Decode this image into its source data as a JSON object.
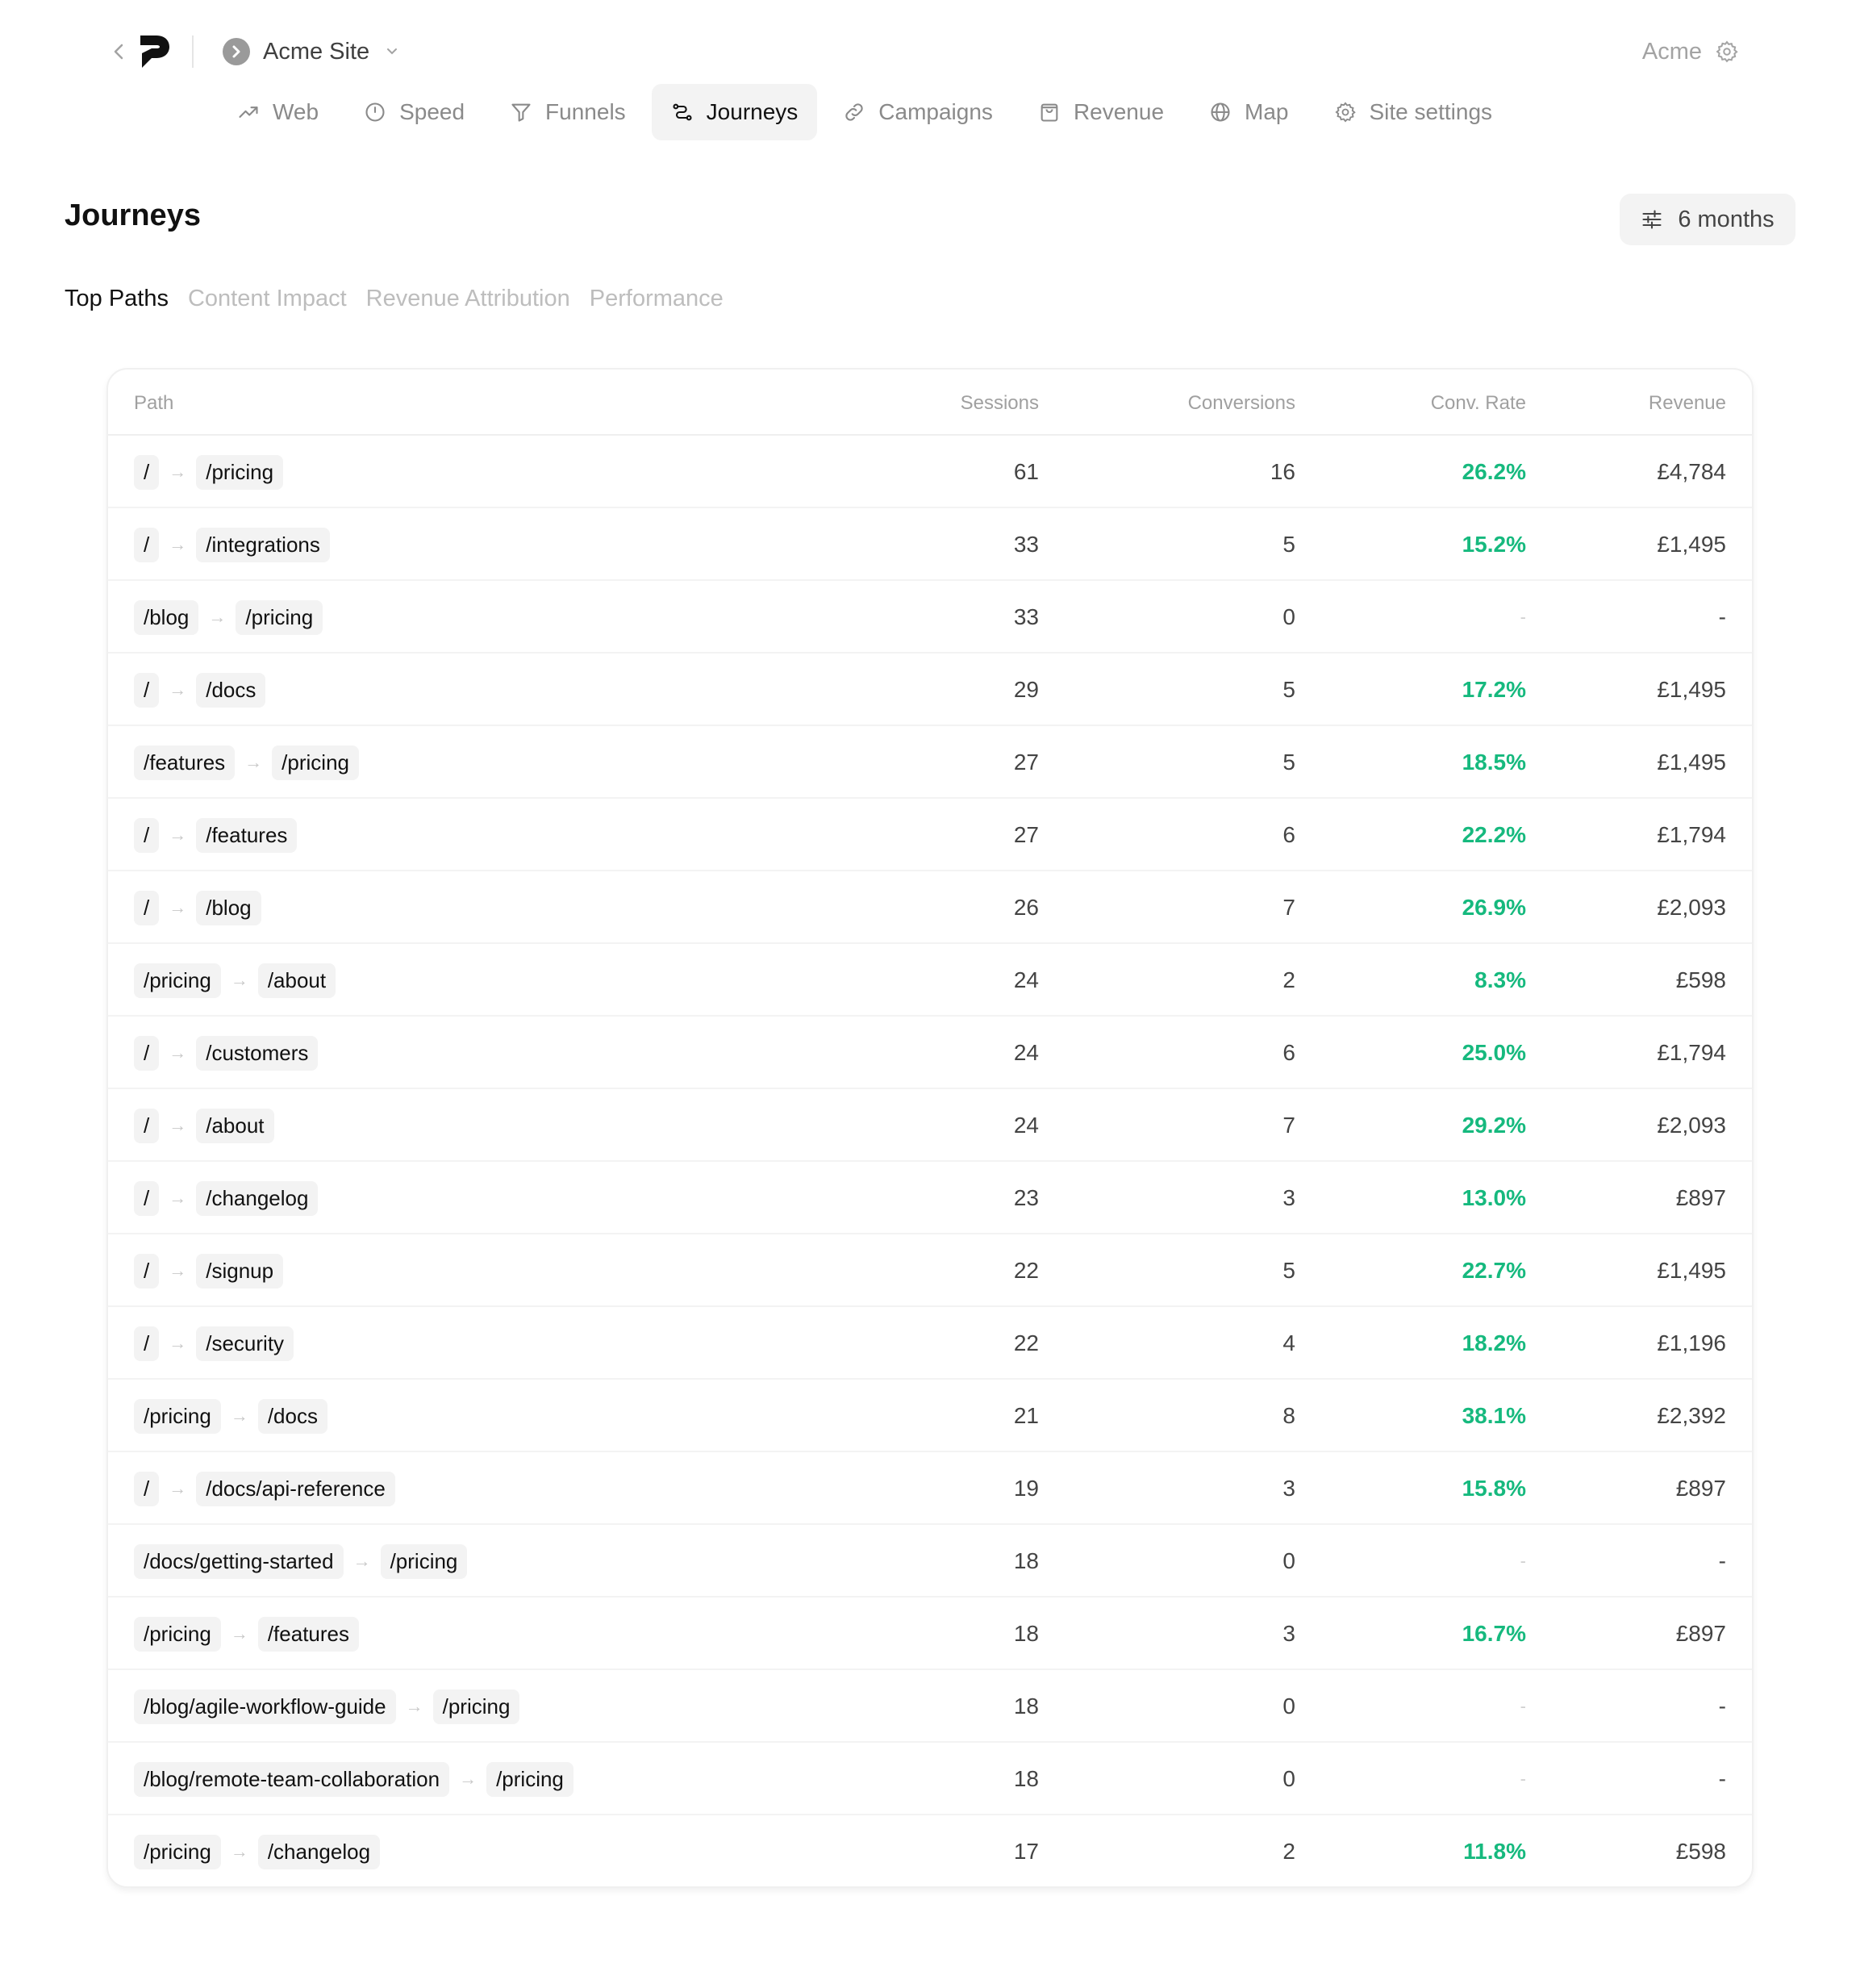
{
  "header": {
    "site_name": "Acme Site",
    "account_name": "Acme"
  },
  "nav": [
    {
      "label": "Web",
      "icon": "trend-up-icon",
      "active": false
    },
    {
      "label": "Speed",
      "icon": "gauge-icon",
      "active": false
    },
    {
      "label": "Funnels",
      "icon": "funnel-icon",
      "active": false
    },
    {
      "label": "Journeys",
      "icon": "route-icon",
      "active": true
    },
    {
      "label": "Campaigns",
      "icon": "link-icon",
      "active": false
    },
    {
      "label": "Revenue",
      "icon": "shopping-bag-icon",
      "active": false
    },
    {
      "label": "Map",
      "icon": "globe-icon",
      "active": false
    },
    {
      "label": "Site settings",
      "icon": "gear-icon",
      "active": false
    }
  ],
  "page": {
    "title": "Journeys",
    "range_label": "6 months"
  },
  "subtabs": [
    {
      "label": "Top Paths",
      "active": true
    },
    {
      "label": "Content Impact",
      "active": false
    },
    {
      "label": "Revenue Attribution",
      "active": false
    },
    {
      "label": "Performance",
      "active": false
    }
  ],
  "table": {
    "columns": {
      "path": "Path",
      "sessions": "Sessions",
      "conversions": "Conversions",
      "rate": "Conv. Rate",
      "revenue": "Revenue"
    },
    "rows": [
      {
        "from": "/",
        "to": "/pricing",
        "sessions": "61",
        "conversions": "16",
        "rate": "26.2%",
        "revenue": "£4,784"
      },
      {
        "from": "/",
        "to": "/integrations",
        "sessions": "33",
        "conversions": "5",
        "rate": "15.2%",
        "revenue": "£1,495"
      },
      {
        "from": "/blog",
        "to": "/pricing",
        "sessions": "33",
        "conversions": "0",
        "rate": "-",
        "revenue": "-"
      },
      {
        "from": "/",
        "to": "/docs",
        "sessions": "29",
        "conversions": "5",
        "rate": "17.2%",
        "revenue": "£1,495"
      },
      {
        "from": "/features",
        "to": "/pricing",
        "sessions": "27",
        "conversions": "5",
        "rate": "18.5%",
        "revenue": "£1,495"
      },
      {
        "from": "/",
        "to": "/features",
        "sessions": "27",
        "conversions": "6",
        "rate": "22.2%",
        "revenue": "£1,794"
      },
      {
        "from": "/",
        "to": "/blog",
        "sessions": "26",
        "conversions": "7",
        "rate": "26.9%",
        "revenue": "£2,093"
      },
      {
        "from": "/pricing",
        "to": "/about",
        "sessions": "24",
        "conversions": "2",
        "rate": "8.3%",
        "revenue": "£598"
      },
      {
        "from": "/",
        "to": "/customers",
        "sessions": "24",
        "conversions": "6",
        "rate": "25.0%",
        "revenue": "£1,794"
      },
      {
        "from": "/",
        "to": "/about",
        "sessions": "24",
        "conversions": "7",
        "rate": "29.2%",
        "revenue": "£2,093"
      },
      {
        "from": "/",
        "to": "/changelog",
        "sessions": "23",
        "conversions": "3",
        "rate": "13.0%",
        "revenue": "£897"
      },
      {
        "from": "/",
        "to": "/signup",
        "sessions": "22",
        "conversions": "5",
        "rate": "22.7%",
        "revenue": "£1,495"
      },
      {
        "from": "/",
        "to": "/security",
        "sessions": "22",
        "conversions": "4",
        "rate": "18.2%",
        "revenue": "£1,196"
      },
      {
        "from": "/pricing",
        "to": "/docs",
        "sessions": "21",
        "conversions": "8",
        "rate": "38.1%",
        "revenue": "£2,392"
      },
      {
        "from": "/",
        "to": "/docs/api-reference",
        "sessions": "19",
        "conversions": "3",
        "rate": "15.8%",
        "revenue": "£897"
      },
      {
        "from": "/docs/getting-started",
        "to": "/pricing",
        "sessions": "18",
        "conversions": "0",
        "rate": "-",
        "revenue": "-"
      },
      {
        "from": "/pricing",
        "to": "/features",
        "sessions": "18",
        "conversions": "3",
        "rate": "16.7%",
        "revenue": "£897"
      },
      {
        "from": "/blog/agile-workflow-guide",
        "to": "/pricing",
        "sessions": "18",
        "conversions": "0",
        "rate": "-",
        "revenue": "-"
      },
      {
        "from": "/blog/remote-team-collaboration",
        "to": "/pricing",
        "sessions": "18",
        "conversions": "0",
        "rate": "-",
        "revenue": "-"
      },
      {
        "from": "/pricing",
        "to": "/changelog",
        "sessions": "17",
        "conversions": "2",
        "rate": "11.8%",
        "revenue": "£598"
      }
    ]
  },
  "colors": {
    "positive": "#16b97e",
    "muted": "#a0a0a0",
    "active_bg": "#f3f3f3"
  }
}
